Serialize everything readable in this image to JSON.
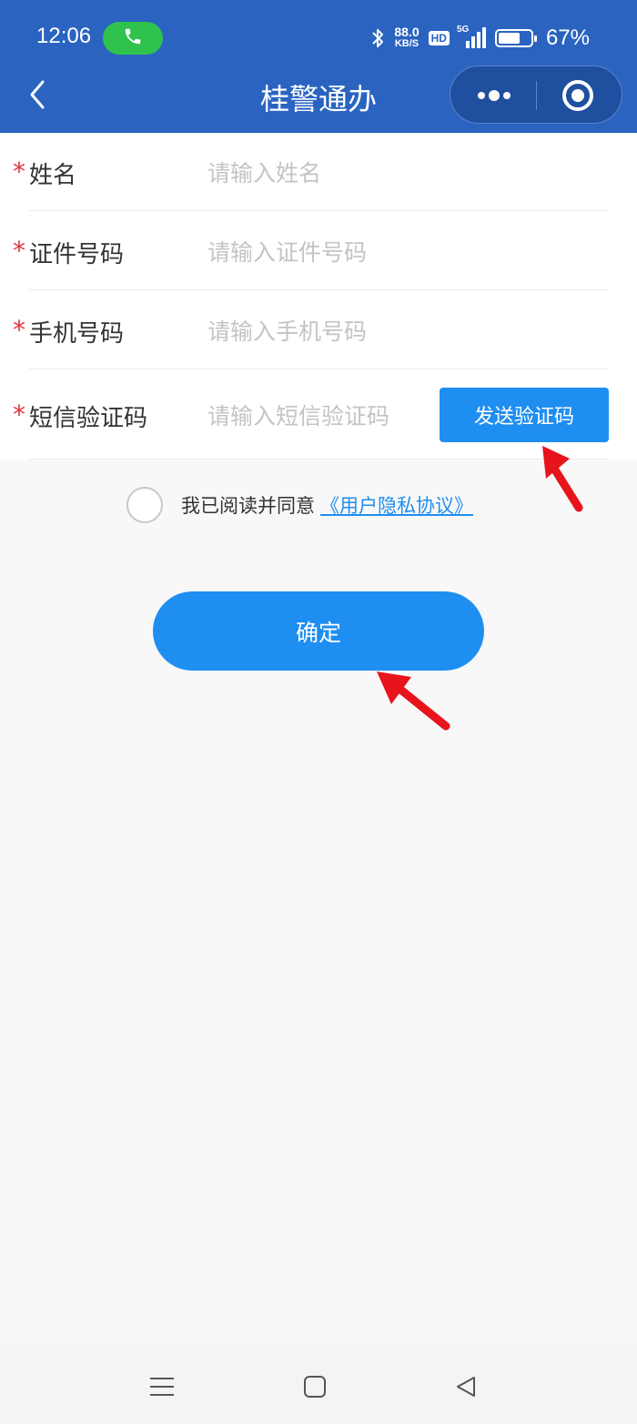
{
  "status_bar": {
    "time": "12:06",
    "net_speed_value": "88.0",
    "net_speed_unit": "KB/S",
    "hd_label": "HD",
    "signal_label": "5G",
    "battery_percent": "67%",
    "battery_level": 0.67
  },
  "nav": {
    "title": "桂警通办"
  },
  "form": {
    "required_mark": "*",
    "fields": [
      {
        "label": "姓名",
        "placeholder": "请输入姓名",
        "value": ""
      },
      {
        "label": "证件号码",
        "placeholder": "请输入证件号码",
        "value": ""
      },
      {
        "label": "手机号码",
        "placeholder": "请输入手机号码",
        "value": ""
      },
      {
        "label": "短信验证码",
        "placeholder": "请输入短信验证码",
        "value": ""
      }
    ],
    "send_code_label": "发送验证码"
  },
  "agreement": {
    "text": "我已阅读并同意",
    "link": "《用户隐私协议》",
    "checked": false
  },
  "confirm_label": "确定",
  "colors": {
    "header_bg": "#2a64c0",
    "primary": "#1f8ef1",
    "required": "#e3323b",
    "annotation_arrow": "#e8141c"
  }
}
